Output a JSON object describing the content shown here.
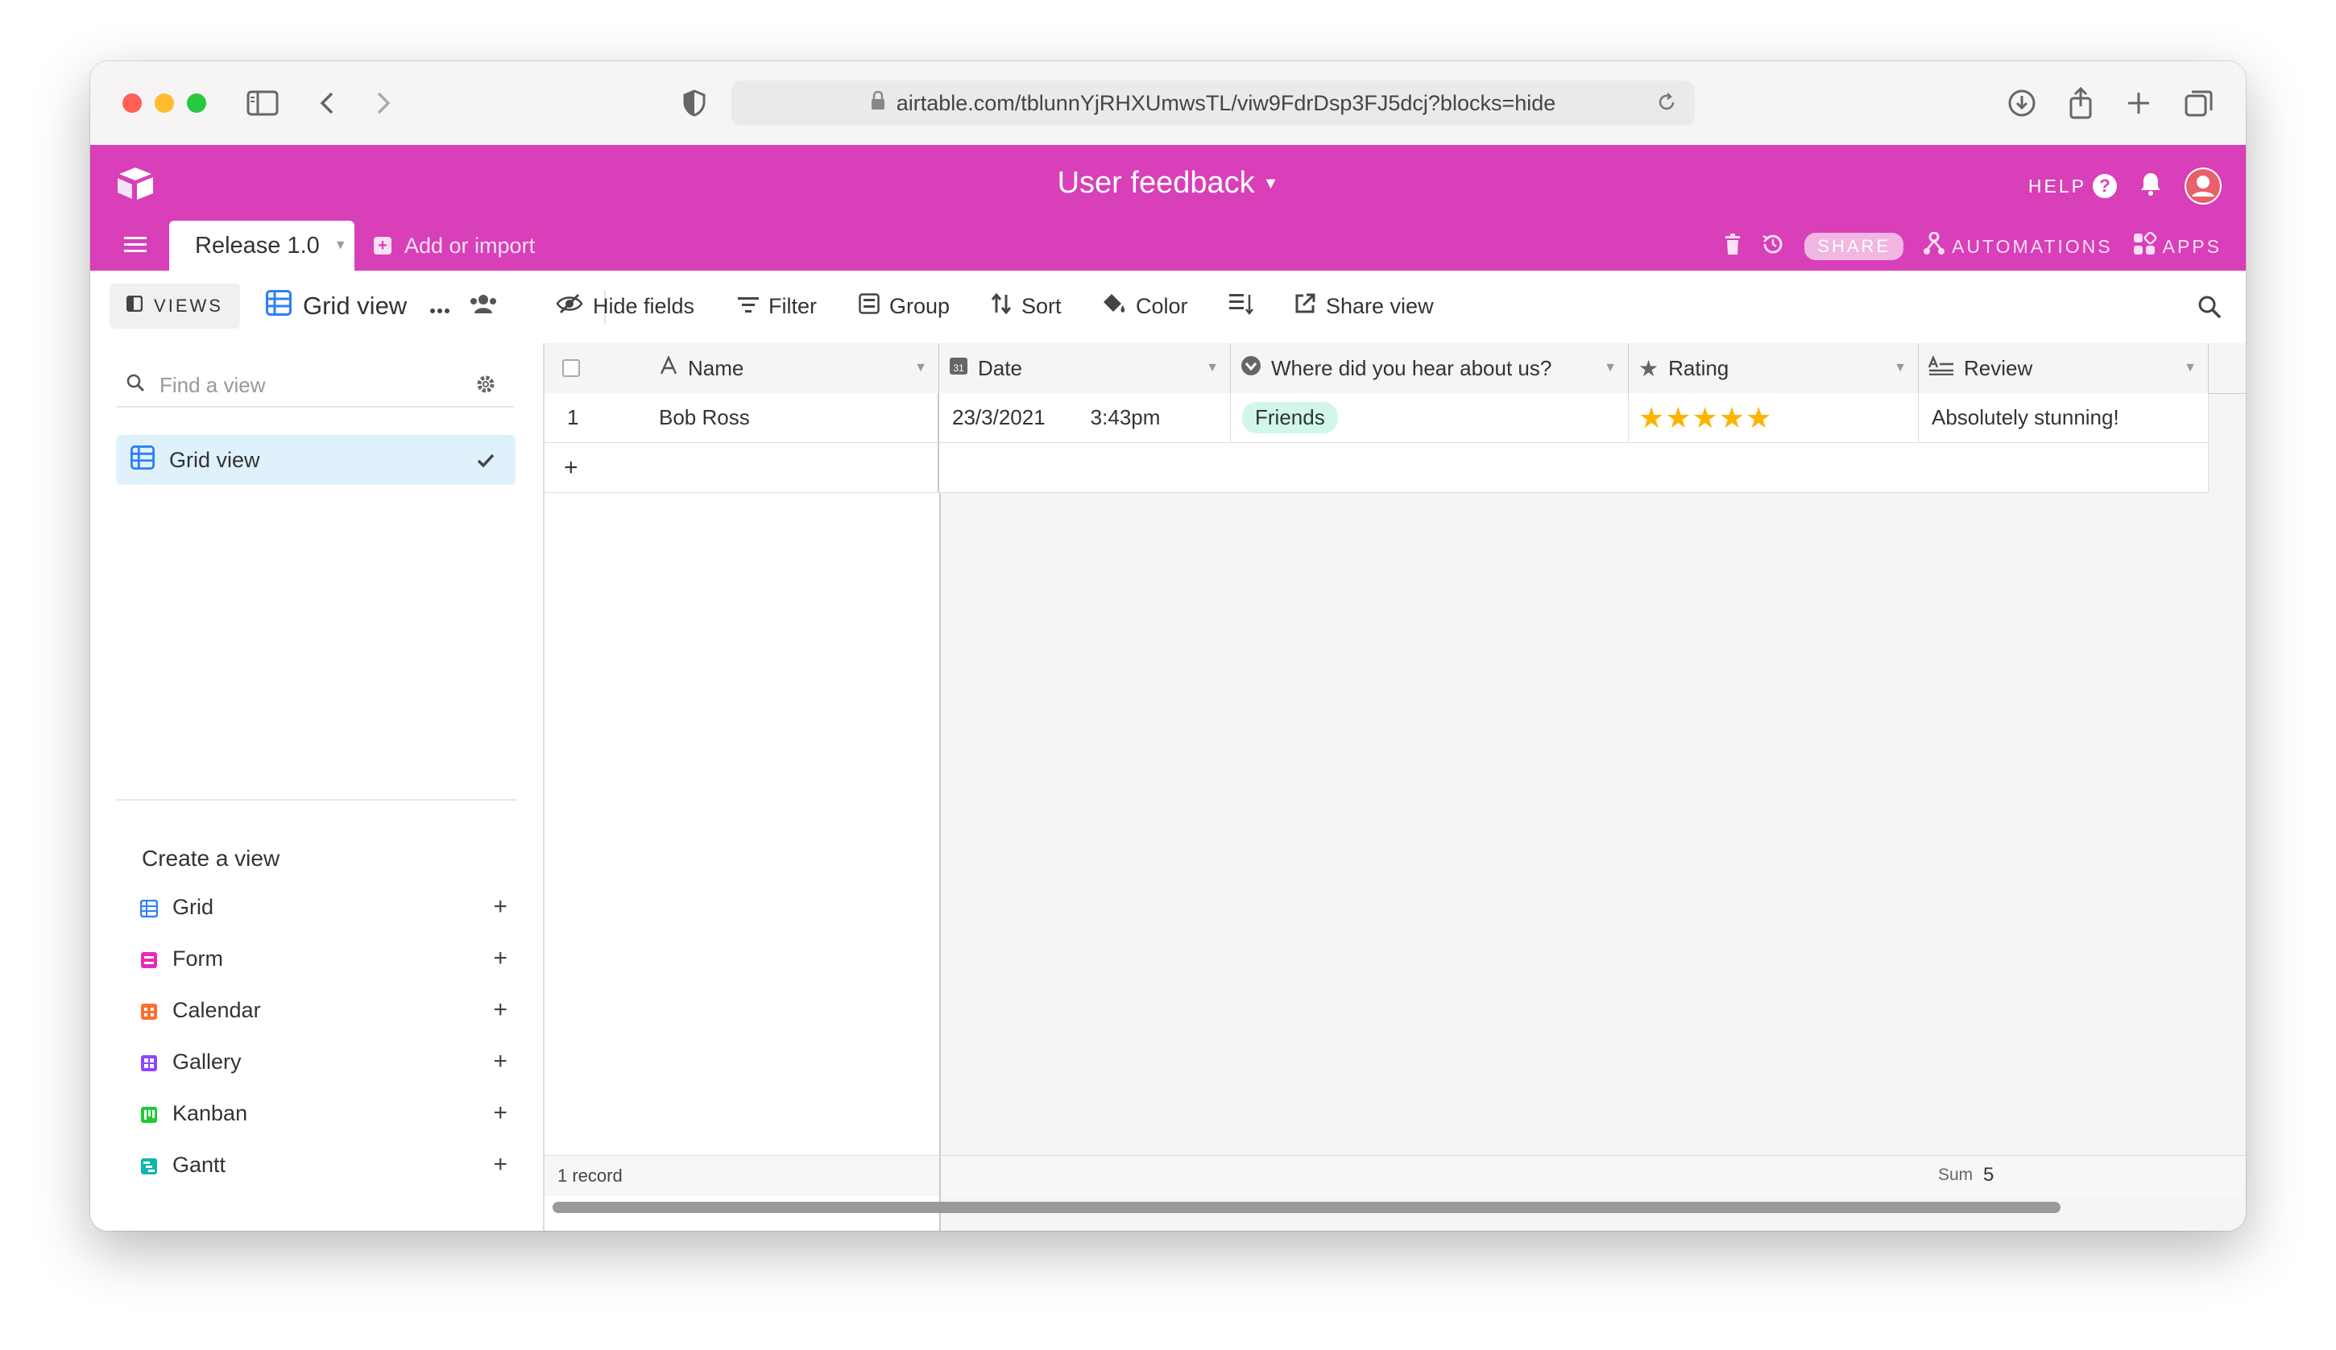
{
  "browser": {
    "url": "airtable.com/tblunnYjRHXUmwsTL/viw9FdrDsp3FJ5dcj?blocks=hide"
  },
  "header": {
    "base_title": "User feedback",
    "help_label": "HELP",
    "help_icon": "?",
    "table_tab": "Release 1.0",
    "add_import": "Add or import",
    "share_label": "SHARE",
    "automations_label": "AUTOMATIONS",
    "apps_label": "APPS",
    "brand_color": "#d83fb8"
  },
  "viewbar": {
    "views_label": "VIEWS",
    "current_view": "Grid view",
    "hide_fields": "Hide fields",
    "filter": "Filter",
    "group": "Group",
    "sort": "Sort",
    "color": "Color",
    "share_view": "Share view"
  },
  "sidebar": {
    "find_placeholder": "Find a view",
    "active_view": "Grid view",
    "create_title": "Create a view",
    "create_items": [
      {
        "label": "Grid",
        "color": "#2d7ff9"
      },
      {
        "label": "Form",
        "color": "#e929ba"
      },
      {
        "label": "Calendar",
        "color": "#ff6f2c"
      },
      {
        "label": "Gallery",
        "color": "#8b46ff"
      },
      {
        "label": "Kanban",
        "color": "#20c933"
      },
      {
        "label": "Gantt",
        "color": "#20d9d2"
      }
    ]
  },
  "grid": {
    "columns": [
      "Name",
      "Date",
      "Where did you hear about us?",
      "Rating",
      "Review"
    ],
    "rows": [
      {
        "num": "1",
        "name": "Bob Ross",
        "date": "23/3/2021",
        "time": "3:43pm",
        "source": "Friends",
        "rating": 5,
        "rating_stars": "★★★★★",
        "review": "Absolutely stunning!"
      }
    ],
    "add_row": "+",
    "record_count": "1 record",
    "sum_label": "Sum",
    "sum_value": "5"
  }
}
